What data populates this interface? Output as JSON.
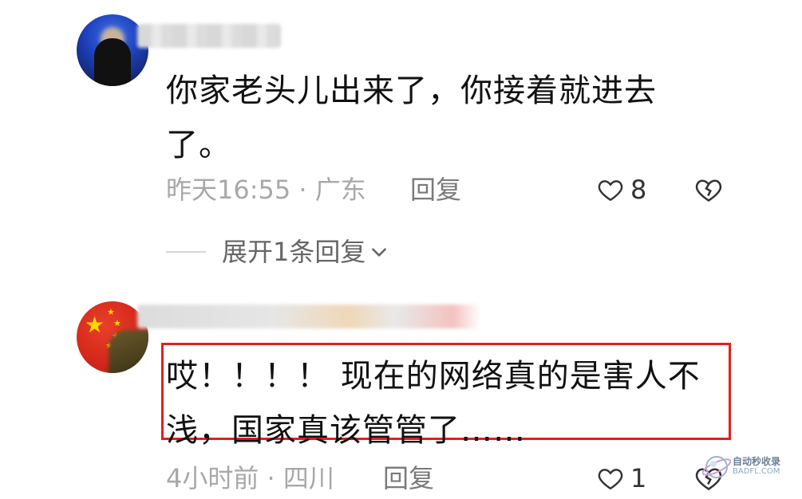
{
  "comments": [
    {
      "text": "你家老头儿出来了，你接着就进去了。",
      "time": "昨天16:55",
      "location": "广东",
      "reply_label": "回复",
      "likes": "8",
      "expand_label": "展开1条回复"
    },
    {
      "text": "哎！！！！ 现在的网络真的是害人不浅，国家真该管管了……",
      "time": "4小时前",
      "location": "四川",
      "reply_label": "回复",
      "likes": "1"
    }
  ],
  "watermark": {
    "title": "自动秒收录",
    "url": "BADFL.COM"
  },
  "colors": {
    "highlight": "#e0201e",
    "meta_text": "#a8a8a8"
  },
  "icons": [
    "heart-outline-icon",
    "broken-heart-icon",
    "chevron-down-icon"
  ]
}
